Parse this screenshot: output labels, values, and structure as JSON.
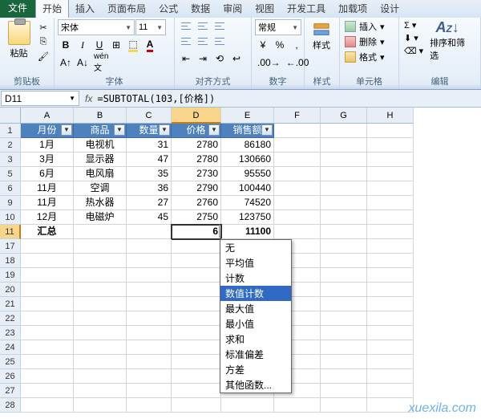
{
  "tabs": {
    "file": "文件",
    "home": "开始",
    "insert": "插入",
    "layout": "页面布局",
    "formula": "公式",
    "data": "数据",
    "review": "审阅",
    "view": "视图",
    "dev": "开发工具",
    "addins": "加载项",
    "design": "设计"
  },
  "groups": {
    "clipboard": "剪贴板",
    "font": "字体",
    "align": "对齐方式",
    "number": "数字",
    "styles": "样式",
    "cells": "单元格",
    "editing": "编辑"
  },
  "clipboard": {
    "paste": "粘贴"
  },
  "font": {
    "name": "宋体",
    "size": "11"
  },
  "number_fmt": "常规",
  "cells": {
    "insert": "插入",
    "delete": "删除",
    "format": "格式"
  },
  "sort": "排序和筛选",
  "namebox": "D11",
  "formula": "=SUBTOTAL(103,[价格])",
  "cols": [
    "A",
    "B",
    "C",
    "D",
    "E",
    "F",
    "G",
    "H"
  ],
  "row_nums": [
    1,
    2,
    3,
    5,
    6,
    9,
    10,
    11,
    17,
    18,
    19,
    20,
    21,
    22,
    23,
    24,
    25,
    26,
    27,
    28
  ],
  "headers": [
    "月份",
    "商品",
    "数量",
    "价格",
    "销售额"
  ],
  "rows": [
    {
      "a": "1月",
      "b": "电视机",
      "c": "31",
      "d": "2780",
      "e": "86180"
    },
    {
      "a": "3月",
      "b": "显示器",
      "c": "47",
      "d": "2780",
      "e": "130660"
    },
    {
      "a": "6月",
      "b": "电风扇",
      "c": "35",
      "d": "2730",
      "e": "95550"
    },
    {
      "a": "11月",
      "b": "空调",
      "c": "36",
      "d": "2790",
      "e": "100440"
    },
    {
      "a": "11月",
      "b": "热水器",
      "c": "27",
      "d": "2760",
      "e": "74520"
    },
    {
      "a": "12月",
      "b": "电磁炉",
      "c": "45",
      "d": "2750",
      "e": "123750"
    }
  ],
  "total": {
    "label": "汇总",
    "d": "6",
    "e": "11100"
  },
  "dropdown": [
    "无",
    "平均值",
    "计数",
    "数值计数",
    "最大值",
    "最小值",
    "求和",
    "标准偏差",
    "方差",
    "其他函数..."
  ],
  "watermark": "xuexila.com"
}
